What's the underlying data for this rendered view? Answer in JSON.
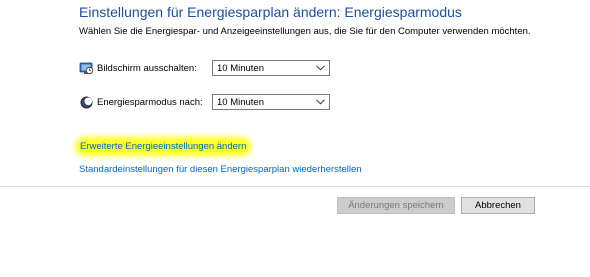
{
  "header": {
    "title": "Einstellungen für Energiesparplan ändern: Energiesparmodus",
    "subtitle": "Wählen Sie die Energiespar- und Anzeigeeinstellungen aus, die Sie für den Computer verwenden möchten."
  },
  "settings": [
    {
      "icon": "display-clock-icon",
      "label": "Bildschirm ausschalten:",
      "value": "10 Minuten"
    },
    {
      "icon": "sleep-moon-icon",
      "label": "Energiesparmodus nach:",
      "value": "10 Minuten"
    }
  ],
  "links": {
    "advanced": "Erweiterte Energieeinstellungen ändern",
    "restore_defaults": "Standardeinstellungen für diesen Energiesparplan wiederherstellen"
  },
  "highlight_color": "#ffff22",
  "buttons": {
    "save": "Änderungen speichern",
    "cancel": "Abbrechen"
  }
}
